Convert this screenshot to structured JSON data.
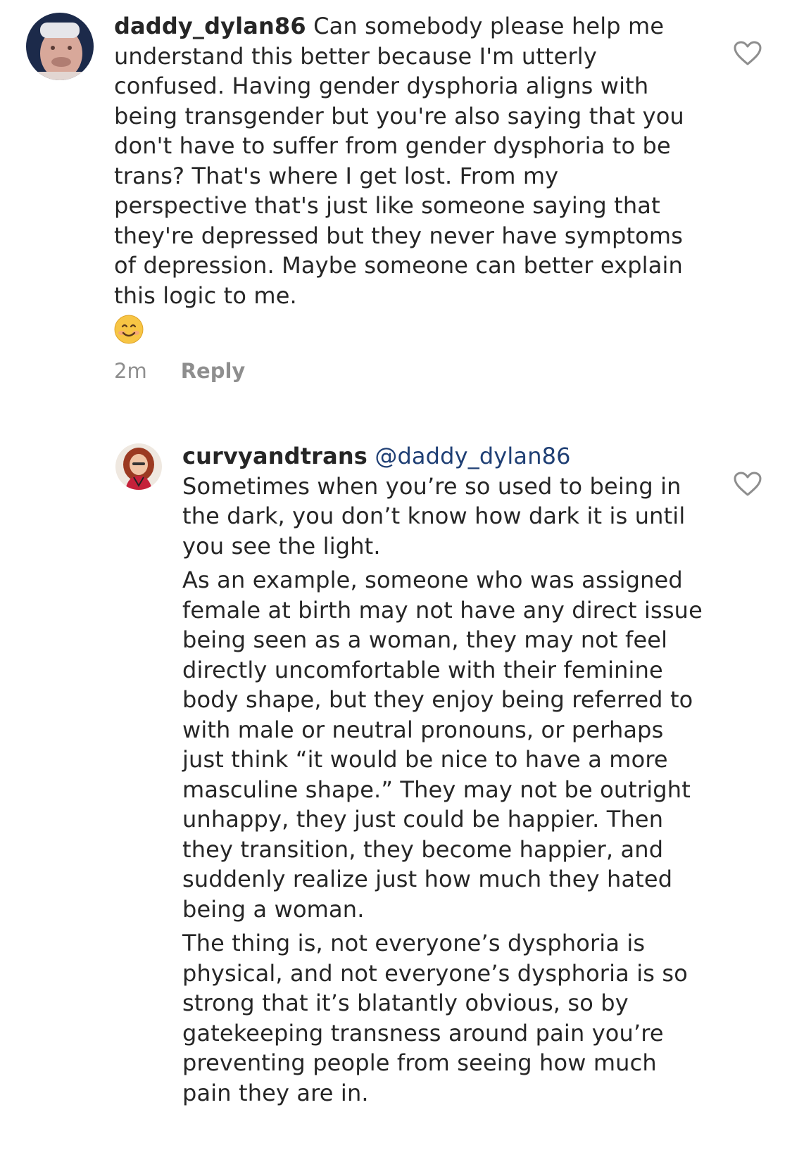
{
  "comments": [
    {
      "username": "daddy_dylan86",
      "text": "Can somebody please help me understand this better because I'm utterly confused. Having gender dysphoria aligns with being transgender but you're also saying that you don't have to suffer from gender dysphoria to be trans? That's where I get lost. From my perspective that's just like someone saying that they're depressed but they never have symptoms of depression. Maybe someone can better explain this logic to me.",
      "emoji_icon": "smiling-face-emoji",
      "time": "2m",
      "reply_label": "Reply",
      "like_icon": "heart-outline-icon"
    }
  ],
  "reply": {
    "username": "curvyandtrans",
    "mention": "@daddy_dylan86",
    "paragraphs": [
      "Sometimes when you’re so used to being in the dark, you don’t know how dark it is until you see the light.",
      "As an example, someone who was assigned female at birth may not have any direct issue being seen as a woman, they may not feel directly uncomfortable with their feminine body shape, but they enjoy being referred to with male or neutral pronouns, or perhaps just think “it would be nice to have a more masculine shape.” They may not be outright unhappy, they just could be happier. Then they transition, they become happier, and suddenly realize just how much they hated being a woman.",
      "The thing is, not everyone’s dysphoria is physical, and not everyone’s dysphoria is so strong that it’s blatantly obvious, so by gatekeeping transness around pain you’re preventing people from seeing how much pain they are in."
    ],
    "like_icon": "heart-outline-icon"
  },
  "colors": {
    "text": "#262626",
    "muted": "#8e8e8e",
    "mention": "#1f3f74",
    "heart_stroke": "#8e8e8e",
    "emoji_face": "#f7c544"
  }
}
